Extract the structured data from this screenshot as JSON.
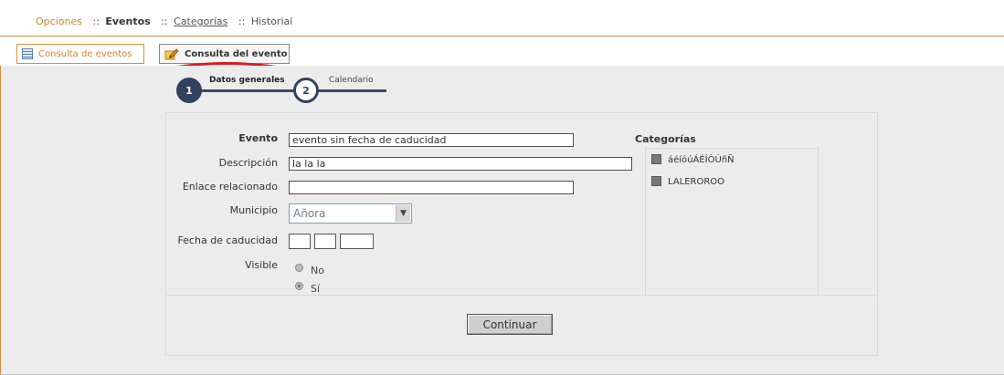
{
  "breadcrumb": {
    "opciones": "Opciones",
    "sep": "::",
    "eventos": "Eventos",
    "categorias": "Categorías",
    "historial": "Historial"
  },
  "tabs": [
    {
      "label": "Consulta de eventos"
    },
    {
      "label": "Consulta del evento"
    }
  ],
  "steps": [
    {
      "number": "1",
      "label": "Datos generales"
    },
    {
      "number": "2",
      "label": "Calendario"
    }
  ],
  "form": {
    "evento_label": "Evento",
    "evento_value": "evento sin fecha de caducidad",
    "descripcion_label": "Descripción",
    "descripcion_value": "la la la",
    "enlace_label": "Enlace relacionado",
    "enlace_value": "",
    "municipio_label": "Municipio",
    "municipio_value": "Añora",
    "fecha_label": "Fecha de caducidad",
    "visible_label": "Visible",
    "visible_options": [
      "No",
      "Sí"
    ],
    "visible_selected": "Sí"
  },
  "categorias": {
    "title": "Categorías",
    "items": [
      {
        "label": "áéíóúÁÉÍÓÚñÑ",
        "checked": false
      },
      {
        "label": "LALEROROO",
        "checked": false
      }
    ]
  },
  "actions": {
    "continuar_label": "Continuar"
  },
  "colors": {
    "accent_orange": "#e08b3a",
    "highlight_red": "#e3161d",
    "step_navy": "#34415e",
    "panel_gray": "#ececec"
  },
  "icons": {
    "tab1": "table-icon",
    "tab2": "edit-pencil-icon",
    "municipio_dropdown": "chevron-down-icon"
  }
}
